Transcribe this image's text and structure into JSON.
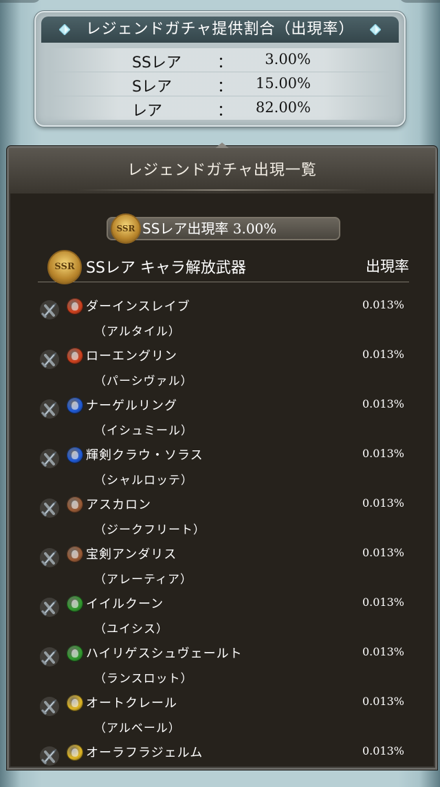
{
  "rate_box": {
    "title": "レジェンドガチャ提供割合（出現率）",
    "rows": [
      {
        "label": "SSレア",
        "colon": "：",
        "value": "3.00%"
      },
      {
        "label": "Sレア",
        "colon": "：",
        "value": "15.00%"
      },
      {
        "label": "レア",
        "colon": "：",
        "value": "82.00%"
      }
    ]
  },
  "panel": {
    "title": "レジェンドガチャ出現一覧",
    "ssr_rate_label": "SSレア出現率",
    "ssr_rate_value": "3.00%",
    "ssr_badge_text": "SSR",
    "list_header_title": "SSレア キャラ解放武器",
    "list_header_rate": "出現率"
  },
  "element_colors": {
    "fire": "#d0401c",
    "water": "#1e5ad8",
    "earth": "#9a5a34",
    "wind": "#2f9a2c",
    "light": "#e0b622"
  },
  "items": [
    {
      "name": "ダーインスレイブ",
      "character": "（アルタイル）",
      "rate": "0.013%",
      "element": "fire"
    },
    {
      "name": "ローエングリン",
      "character": "（パーシヴァル）",
      "rate": "0.013%",
      "element": "fire"
    },
    {
      "name": "ナーゲルリング",
      "character": "（イシュミール）",
      "rate": "0.013%",
      "element": "water"
    },
    {
      "name": "輝剣クラウ・ソラス",
      "character": "（シャルロッテ）",
      "rate": "0.013%",
      "element": "water"
    },
    {
      "name": "アスカロン",
      "character": "（ジークフリート）",
      "rate": "0.013%",
      "element": "earth"
    },
    {
      "name": "宝剣アンダリス",
      "character": "（アレーティア）",
      "rate": "0.013%",
      "element": "earth"
    },
    {
      "name": "イイルクーン",
      "character": "（ユイシス）",
      "rate": "0.013%",
      "element": "wind"
    },
    {
      "name": "ハイリゲスシュヴェールト",
      "character": "（ランスロット）",
      "rate": "0.013%",
      "element": "wind"
    },
    {
      "name": "オートクレール",
      "character": "（アルベール）",
      "rate": "0.013%",
      "element": "light"
    },
    {
      "name": "オーラフラジェルム",
      "character": "",
      "rate": "0.013%",
      "element": "light"
    }
  ]
}
